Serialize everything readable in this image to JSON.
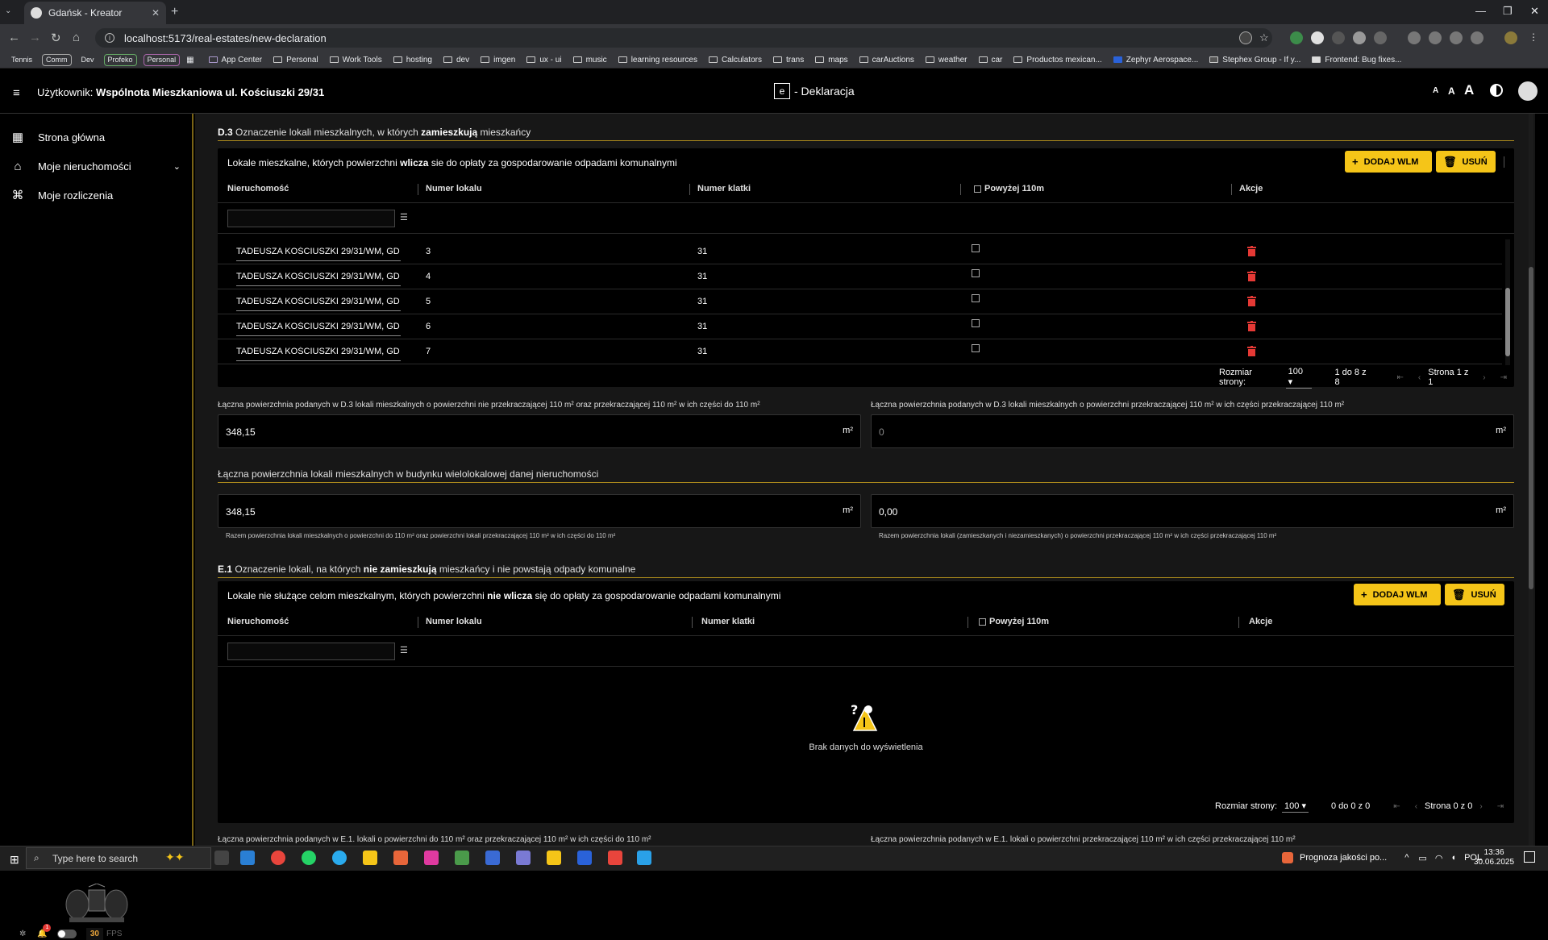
{
  "browser": {
    "tab_title": "Gdańsk - Kreator",
    "url": "localhost:5173/real-estates/new-declaration",
    "bookmark_tags": [
      "Tennis",
      "Comm",
      "Dev",
      "Profeko",
      "Personal"
    ],
    "bookmarks": [
      "App Center",
      "Personal",
      "Work Tools",
      "hosting",
      "dev",
      "imgen",
      "ux - ui",
      "music",
      "learning resources",
      "Calculators",
      "trans",
      "maps",
      "carAuctions",
      "weather",
      "car",
      "Productos mexican...",
      "Zephyr Aerospace...",
      "Stephex Group - If y...",
      "Frontend: Bug fixes..."
    ]
  },
  "header": {
    "user_prefix": "Użytkownik:",
    "user_name": "Wspólnota Mieszkaniowa ul. Kościuszki 29/31",
    "logo_letter": "e",
    "title": "- Deklaracja",
    "font_small": "A",
    "font_medium": "A",
    "font_large": "A"
  },
  "sidebar": {
    "items": [
      {
        "label": "Strona główna",
        "icon": "grid-icon"
      },
      {
        "label": "Moje nieruchomości",
        "icon": "building-icon"
      },
      {
        "label": "Moje rozliczenia",
        "icon": "bank-icon"
      }
    ],
    "badge_count": "1",
    "fps_value": "30",
    "fps_label": "FPS"
  },
  "section_d3": {
    "code": "D.3",
    "title_pre": "Oznaczenie lokali mieszkalnych, w których",
    "title_bold": "zamieszkują",
    "title_post": "mieszkańcy"
  },
  "panel_d3": {
    "title_pre": "Lokale mieszkalne, których powierzchni",
    "title_bold": "wlicza",
    "title_post": "sie do opłaty za gospodarowanie odpadami komunalnymi",
    "add_button": "DODAJ WLM",
    "delete_button": "USUŃ",
    "columns": [
      "Nieruchomość",
      "Numer lokalu",
      "Numer klatki",
      "Powyżej 110m",
      "Akcje"
    ],
    "rows": [
      {
        "property": "TADEUSZA KOŚCIUSZKI 29/31/WM, GD",
        "unit": "3",
        "staircase": "31"
      },
      {
        "property": "TADEUSZA KOŚCIUSZKI 29/31/WM, GD",
        "unit": "4",
        "staircase": "31"
      },
      {
        "property": "TADEUSZA KOŚCIUSZKI 29/31/WM, GD",
        "unit": "5",
        "staircase": "31"
      },
      {
        "property": "TADEUSZA KOŚCIUSZKI 29/31/WM, GD",
        "unit": "6",
        "staircase": "31"
      },
      {
        "property": "TADEUSZA KOŚCIUSZKI 29/31/WM, GD",
        "unit": "7",
        "staircase": "31"
      }
    ],
    "page_size_label": "Rozmiar strony:",
    "page_size": "100",
    "range": "1 do 8 z 8",
    "page_info": "Strona 1 z 1"
  },
  "d3_totals": {
    "left_label": "Łączna powierzchnia podanych w D.3 lokali mieszkalnych o powierzchni nie przekraczającej 110 m² oraz przekraczającej 110 m² w ich części do 110 m²",
    "left_value": "348,15",
    "right_label": "Łączna powierzchnia podanych w D.3 lokali mieszkalnych o powierzchni przekraczającej 110 m² w ich części przekraczającej 110 m²",
    "right_value": "0",
    "unit": "m²"
  },
  "building_totals": {
    "title": "Łączna powierzchnia lokali mieszkalnych w budynku wielolokalowej danej nieruchomości",
    "left_value": "348,15",
    "left_helper": "Razem powierzchnia lokali mieszkalnych o powierzchni do 110 m² oraz powierzchni lokali przekraczającej 110 m² w ich części do 110 m²",
    "right_value": "0,00",
    "right_helper": "Razem powierzchnia lokali (zamieszkanych i niezamieszkanych) o powierzchni przekraczającej 110 m² w ich części przekraczającej 110 m²",
    "unit": "m²"
  },
  "section_e1": {
    "code": "E.1",
    "title_pre": "Oznaczenie lokali, na których",
    "title_bold": "nie zamieszkują",
    "title_post": "mieszkańcy i nie powstają odpady komunalne"
  },
  "panel_e1": {
    "title_pre": "Lokale nie służące celom mieszkalnym, których powierzchni",
    "title_bold": "nie wlicza",
    "title_post": "się do opłaty za gospodarowanie odpadami komunalnymi",
    "add_button": "DODAJ WLM",
    "delete_button": "USUŃ",
    "columns": [
      "Nieruchomość",
      "Numer lokalu",
      "Numer klatki",
      "Powyżej 110m",
      "Akcje"
    ],
    "empty_text": "Brak danych do wyświetlenia",
    "page_size_label": "Rozmiar strony:",
    "page_size": "100",
    "range": "0 do 0 z 0",
    "page_info": "Strona 0 z 0"
  },
  "e1_totals": {
    "left_label": "Łączna powierzchnia podanych w E.1. lokali o powierzchni do 110 m² oraz przekraczającej 110 m² w ich części do 110 m²",
    "right_label": "Łączna powierzchnia podanych w E.1. lokali o powierzchni przekraczającej 110 m² w ich części przekraczającej 110 m²"
  },
  "taskbar": {
    "search_placeholder": "Type here to search",
    "weather_text": "Prognoza jakości po...",
    "lang": "POL",
    "time": "13:36",
    "date": "30.06.2025"
  },
  "colors": {
    "accent": "#f5c518",
    "delete": "#e53935",
    "section_rule": "#a9881c"
  }
}
